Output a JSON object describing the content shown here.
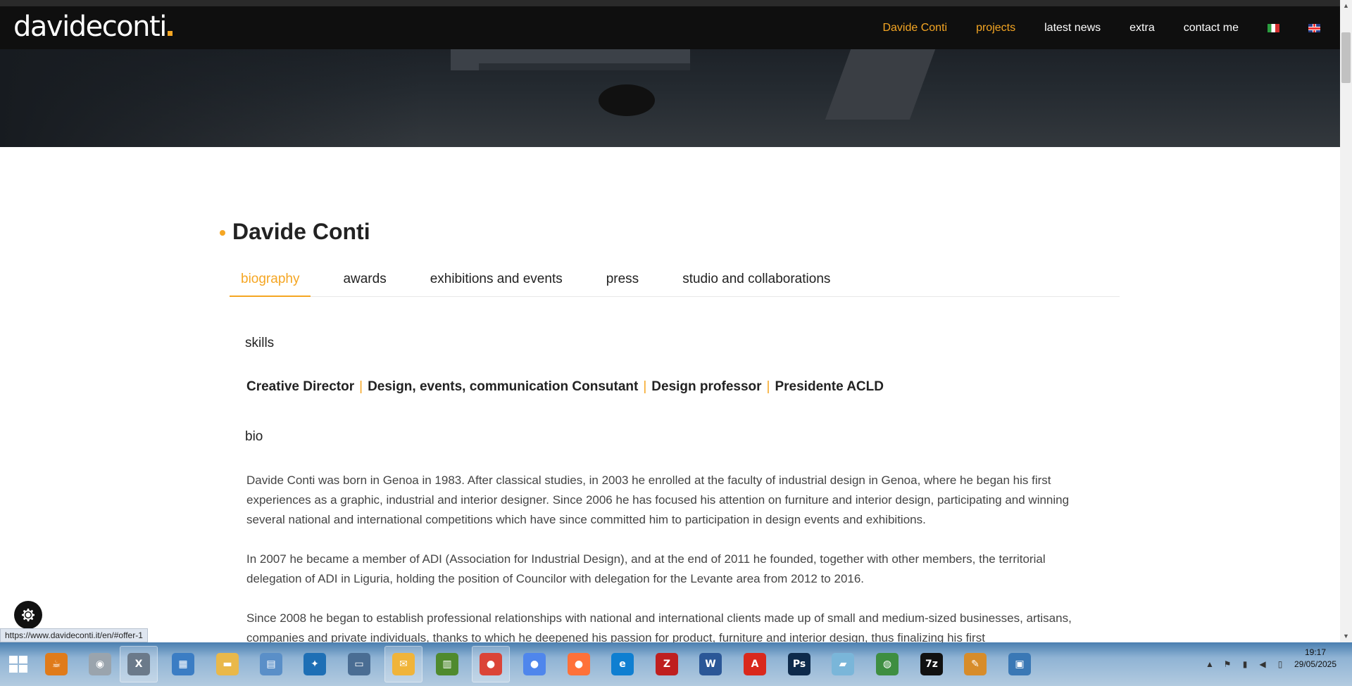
{
  "header": {
    "logo_text": "davideconti",
    "nav": [
      {
        "label": "Davide Conti",
        "active": true
      },
      {
        "label": "projects",
        "active": true
      },
      {
        "label": "latest news",
        "active": false
      },
      {
        "label": "extra",
        "active": false
      },
      {
        "label": "contact me",
        "active": false
      }
    ]
  },
  "page": {
    "title": "Davide Conti",
    "tabs": [
      {
        "label": "biography",
        "active": true
      },
      {
        "label": "awards",
        "active": false
      },
      {
        "label": "exhibitions and events",
        "active": false
      },
      {
        "label": "press",
        "active": false
      },
      {
        "label": "studio and collaborations",
        "active": false
      }
    ],
    "skills_heading": "skills",
    "skills": [
      "Creative Director",
      "Design, events, communication Consutant",
      "Design professor",
      "Presidente ACLD"
    ],
    "skills_separator": "|",
    "bio_heading": "bio",
    "paragraphs": [
      "Davide Conti was born in Genoa in 1983. After classical studies, in 2003 he enrolled at the faculty of industrial design in Genoa, where he began his first experiences as a graphic, industrial and interior designer. Since 2006 he has focused his attention on furniture and interior design, participating and winning several national and international competitions which have since committed him to participation in design events and exhibitions.",
      "In 2007 he became a member of ADI (Association for Industrial Design), and at the end of 2011 he founded, together with other members, the territorial delegation of ADI in Liguria, holding the position of Councilor with delegation for the Levante area from 2012 to 2016.",
      "Since 2008 he began to establish professional relationships with national and international clients made up of small and medium-sized businesses, artisans, companies and private individuals, thanks to which he deepened his passion for product, furniture and interior design, thus finalizing his first"
    ]
  },
  "status_url": "https://www.davideconti.it/en/#offer-1",
  "colors": {
    "accent": "#f5a623",
    "header_bg": "#0f0f0f",
    "text": "#222222"
  },
  "taskbar": {
    "apps": [
      {
        "name": "java-icon",
        "color": "#e07b1a",
        "glyph": "☕"
      },
      {
        "name": "speaker-icon",
        "color": "#9aa4ad",
        "glyph": "◉"
      },
      {
        "name": "xml-icon",
        "color": "#6b7a8a",
        "glyph": "X"
      },
      {
        "name": "network-icon",
        "color": "#3b7dc4",
        "glyph": "▦"
      },
      {
        "name": "folder-icon",
        "color": "#e9b84a",
        "glyph": "▬"
      },
      {
        "name": "calculator-icon",
        "color": "#5a8fc8",
        "glyph": "▤"
      },
      {
        "name": "butterfly-icon",
        "color": "#1e6fb5",
        "glyph": "✦"
      },
      {
        "name": "computer-icon",
        "color": "#4a6d93",
        "glyph": "▭"
      },
      {
        "name": "mail-icon",
        "color": "#f0b43a",
        "glyph": "✉"
      },
      {
        "name": "spreadsheet-icon",
        "color": "#4f8a2e",
        "glyph": "▥"
      },
      {
        "name": "chrome-icon",
        "color": "#db4437",
        "glyph": "●"
      },
      {
        "name": "chromium-icon",
        "color": "#4f86ec",
        "glyph": "●"
      },
      {
        "name": "firefox-icon",
        "color": "#ff7139",
        "glyph": "●"
      },
      {
        "name": "edge-icon",
        "color": "#0f7fd1",
        "glyph": "e"
      },
      {
        "name": "filezilla-icon",
        "color": "#bf1f1f",
        "glyph": "Z"
      },
      {
        "name": "word-icon",
        "color": "#2b5797",
        "glyph": "W"
      },
      {
        "name": "pdf-icon",
        "color": "#d9281c",
        "glyph": "A"
      },
      {
        "name": "photoshop-icon",
        "color": "#0d2a4b",
        "glyph": "Ps"
      },
      {
        "name": "book-icon",
        "color": "#7ab6d9",
        "glyph": "▰"
      },
      {
        "name": "globe-icon",
        "color": "#3e8e41",
        "glyph": "◍"
      },
      {
        "name": "7zip-icon",
        "color": "#111111",
        "glyph": "7z"
      },
      {
        "name": "paint-icon",
        "color": "#d78c2a",
        "glyph": "✎"
      },
      {
        "name": "display-icon",
        "color": "#3a78b5",
        "glyph": "▣"
      }
    ]
  },
  "tray": {
    "time": "19:17",
    "date": "29/05/2025"
  }
}
